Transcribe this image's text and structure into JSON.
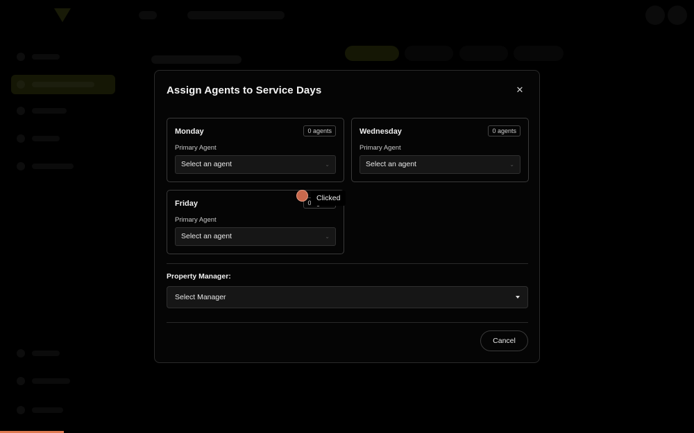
{
  "modal": {
    "title": "Assign Agents to Service Days",
    "close_icon": "close-icon",
    "days": [
      {
        "name": "Monday",
        "badge": "0 agents",
        "field_label": "Primary Agent",
        "select_value": "Select an agent"
      },
      {
        "name": "Wednesday",
        "badge": "0 agents",
        "field_label": "Primary Agent",
        "select_value": "Select an agent"
      },
      {
        "name": "Friday",
        "badge": "0 agents",
        "field_label": "Primary Agent",
        "select_value": "Select an agent"
      }
    ],
    "property_manager": {
      "label": "Property Manager:",
      "select_value": "Select Manager"
    },
    "cancel_label": "Cancel"
  },
  "click_indicator": {
    "label": "Clicked"
  },
  "colors": {
    "accent": "#9fb02a",
    "click_marker": "#c8684c",
    "modal_bg": "#050505",
    "progress_strip": "#e07a52"
  }
}
